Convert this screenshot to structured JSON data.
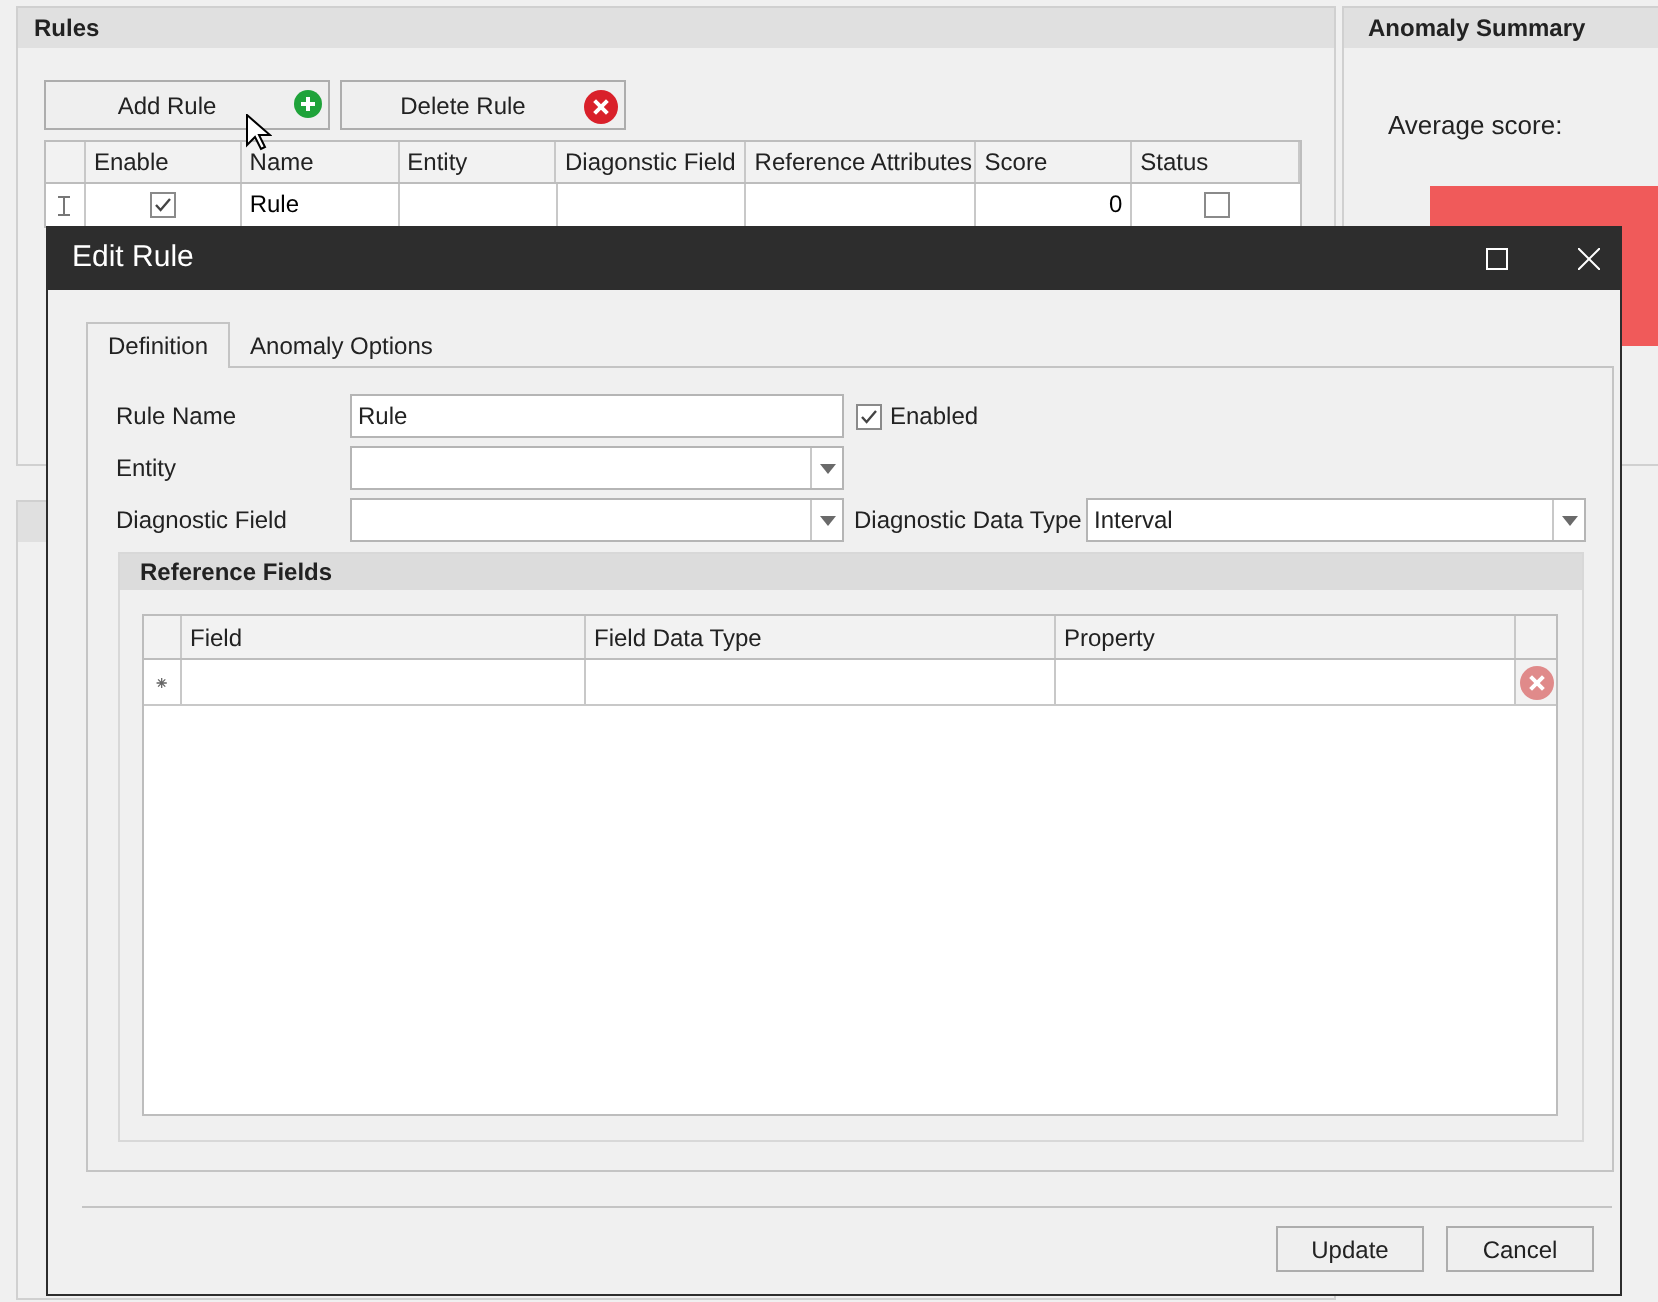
{
  "rules_panel": {
    "title": "Rules",
    "buttons": [
      {
        "label": "Add Rule",
        "kind": "add"
      },
      {
        "label": "Delete Rule",
        "kind": "delete"
      }
    ],
    "table": {
      "columns": [
        "Enable",
        "Name",
        "Entity",
        "Diagonstic Field",
        "Reference Attributes",
        "Score",
        "Status"
      ],
      "rows": [
        {
          "enable_checked": true,
          "name": "Rule",
          "score": "0",
          "status_checked": false
        }
      ]
    }
  },
  "anomaly_summary": {
    "title": "Anomaly Summary",
    "average_score_label": "Average score:"
  },
  "dialog": {
    "title": "Edit Rule",
    "tabs": [
      {
        "label": "Definition",
        "selected": true
      },
      {
        "label": "Anomaly Options",
        "selected": false
      }
    ],
    "rule_name": {
      "label": "Rule Name",
      "value": "Rule"
    },
    "enabled": {
      "label": "Enabled",
      "checked": true
    },
    "entity": {
      "label": "Entity"
    },
    "diagnostic_field": {
      "label": "Diagnostic Field"
    },
    "diagnostic_data_type": {
      "label": "Diagnostic Data Type",
      "value": "Interval"
    },
    "reference_fields": {
      "title": "Reference Fields",
      "columns": [
        "Field",
        "Field Data Type",
        "Property"
      ],
      "new_row_marker": "⁕"
    },
    "buttons": [
      "Update",
      "Cancel"
    ]
  }
}
